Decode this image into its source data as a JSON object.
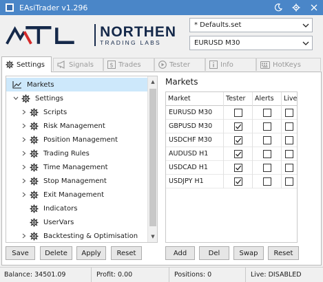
{
  "window": {
    "title": "EAsiTrader v1.296",
    "icons": [
      "app-icon",
      "moon-icon",
      "gear-icon",
      "close-icon"
    ]
  },
  "brand": {
    "name": "NORTHEN",
    "subtitle": "TRADING LABS",
    "colors": {
      "navy": "#15294a",
      "red": "#d42a2a",
      "titlebar": "#4a86c8"
    }
  },
  "header": {
    "settings_file": "* Defaults.set",
    "market": "EURUSD M30"
  },
  "tabs": [
    {
      "label": "Settings",
      "icon": "gear-icon",
      "active": true
    },
    {
      "label": "Signals",
      "icon": "megaphone-icon",
      "active": false
    },
    {
      "label": "Trades",
      "icon": "dollar-icon",
      "active": false
    },
    {
      "label": "Tester",
      "icon": "play-icon",
      "active": false
    },
    {
      "label": "Info",
      "icon": "info-icon",
      "active": false
    },
    {
      "label": "HotKeys",
      "icon": "keyboard-icon",
      "active": false
    }
  ],
  "tree": {
    "items": [
      {
        "label": "Markets",
        "icon": "chart-icon",
        "selected": true
      },
      {
        "label": "Settings",
        "icon": "gear-icon",
        "expanded": true
      },
      {
        "label": "Scripts",
        "icon": "gear-icon"
      },
      {
        "label": "Risk Management",
        "icon": "gear-icon"
      },
      {
        "label": "Position Management",
        "icon": "gear-icon"
      },
      {
        "label": "Trading Rules",
        "icon": "gear-icon"
      },
      {
        "label": "Time Management",
        "icon": "gear-icon"
      },
      {
        "label": "Stop Management",
        "icon": "gear-icon"
      },
      {
        "label": "Exit Management",
        "icon": "gear-icon"
      },
      {
        "label": "Indicators",
        "icon": "gear-icon"
      },
      {
        "label": "UserVars",
        "icon": "gear-icon"
      },
      {
        "label": "Backtesting & Optimisation",
        "icon": "gear-icon"
      }
    ],
    "buttons": {
      "save": "Save",
      "delete": "Delete",
      "apply": "Apply",
      "reset": "Reset"
    }
  },
  "markets": {
    "title": "Markets",
    "columns": [
      "Market",
      "Tester",
      "Alerts",
      "Live"
    ],
    "rows": [
      {
        "market": "EURUSD M30",
        "tester": false,
        "alerts": false,
        "live": false
      },
      {
        "market": "GBPUSD M30",
        "tester": true,
        "alerts": false,
        "live": false
      },
      {
        "market": "USDCHF M30",
        "tester": true,
        "alerts": false,
        "live": false
      },
      {
        "market": "AUDUSD H1",
        "tester": true,
        "alerts": false,
        "live": false
      },
      {
        "market": "USDCAD H1",
        "tester": true,
        "alerts": false,
        "live": false
      },
      {
        "market": "USDJPY H1",
        "tester": true,
        "alerts": false,
        "live": false
      }
    ],
    "buttons": {
      "add": "Add",
      "del": "Del",
      "swap": "Swap",
      "reset": "Reset"
    }
  },
  "status": {
    "balance": "Balance: 34501.09",
    "profit": "Profit: 0.00",
    "positions": "Positions: 0",
    "live": "Live: DISABLED"
  }
}
